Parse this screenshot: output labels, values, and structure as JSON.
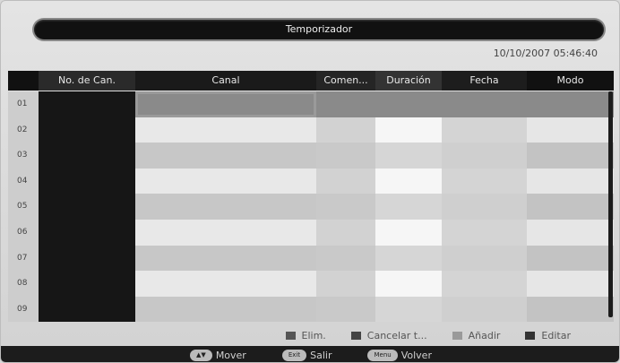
{
  "title": "Temporizador",
  "datetime": "10/10/2007 05:46:40",
  "columns": [
    "No. de Can.",
    "Canal",
    "Comen...",
    "Duración",
    "Fecha",
    "Modo"
  ],
  "rows": [
    "01",
    "02",
    "03",
    "04",
    "05",
    "06",
    "07",
    "08",
    "09"
  ],
  "selected_row": "01",
  "legend": [
    {
      "label": "Elim.",
      "color": "#555555",
      "icon": "red-key-icon"
    },
    {
      "label": "Cancelar t...",
      "color": "#444444",
      "icon": "green-key-icon"
    },
    {
      "label": "Añadir",
      "color": "#9a9a9a",
      "icon": "yellow-key-icon"
    },
    {
      "label": "Editar",
      "color": "#333333",
      "icon": "blue-key-icon"
    }
  ],
  "footer": [
    {
      "key": "▲▼",
      "label": "Mover"
    },
    {
      "key": "Exit",
      "label": "Salir"
    },
    {
      "key": "Menu",
      "label": "Volver"
    }
  ]
}
